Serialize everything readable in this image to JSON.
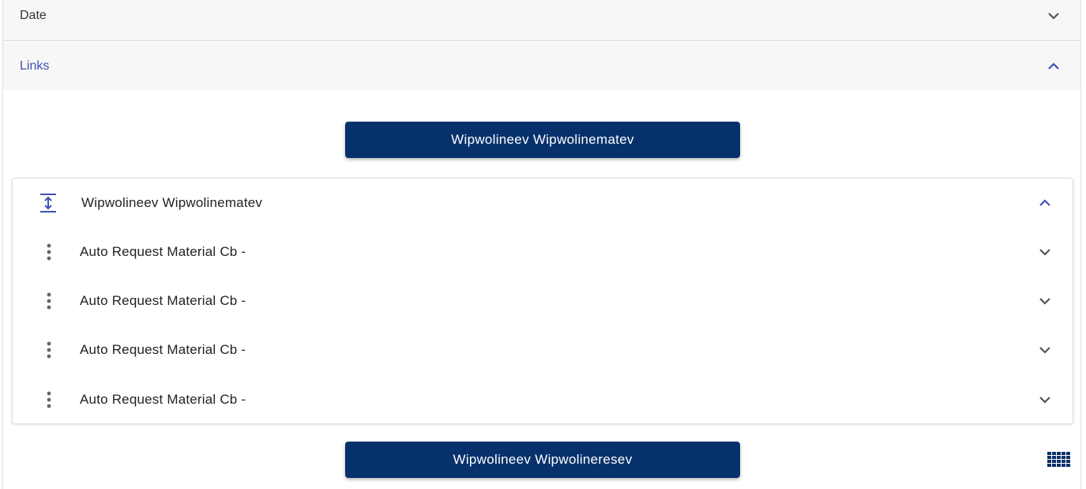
{
  "sections": {
    "date": {
      "label": "Date"
    },
    "links": {
      "label": "Links"
    }
  },
  "buttons": {
    "top": "Wipwolineev Wipwolinematev",
    "bottom": "Wipwolineev Wipwolineresev"
  },
  "panel": {
    "title": "Wipwolineev Wipwolinematev",
    "rows": [
      {
        "label": "Auto Request Material Cb  -"
      },
      {
        "label": "Auto Request Material Cb  -"
      },
      {
        "label": "Auto Request Material Cb  -"
      },
      {
        "label": "Auto Request Material Cb  -"
      }
    ]
  },
  "colors": {
    "primary": "#07316b",
    "accent": "#3f51b5",
    "header_bg": "#f7f7f7"
  },
  "icons": [
    "chevron-down-icon",
    "chevron-up-icon",
    "vertical-expand-icon",
    "more-vert-icon",
    "grid-icon"
  ]
}
